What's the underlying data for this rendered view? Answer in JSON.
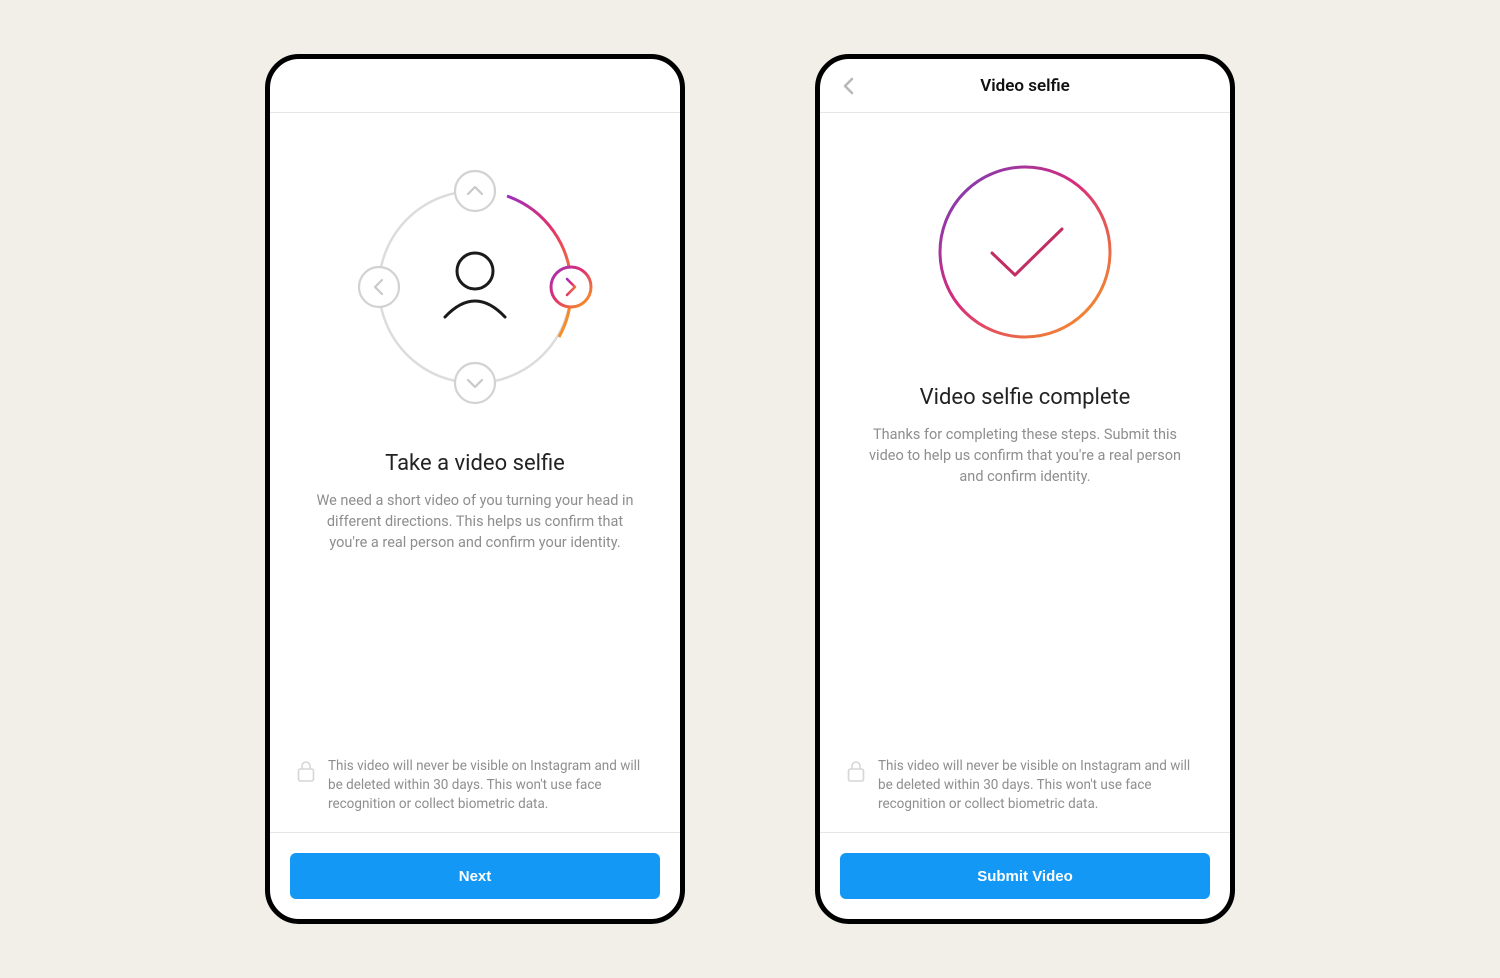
{
  "screens": {
    "left": {
      "header_title": "",
      "title": "Take a video selfie",
      "description": "We need a short video of you turning your head in different directions. This helps us confirm that you're a real person and confirm your identity.",
      "privacy_note": "This video will never be visible on Instagram and will be deleted within 30 days. This won't use face recognition or collect biometric data.",
      "cta_label": "Next"
    },
    "right": {
      "header_title": "Video selfie",
      "title": "Video selfie complete",
      "description": "Thanks for completing these steps. Submit this video to help us confirm that you're a real person and confirm identity.",
      "privacy_note": "This video will never be visible on Instagram and will be deleted within 30 days. This won't use face recognition or collect biometric data.",
      "cta_label": "Submit Video"
    }
  },
  "colors": {
    "button": "#1398f6",
    "text_muted": "#8e8e8e",
    "gradient_purple": "#9b2fbf",
    "gradient_pink": "#e1306c",
    "gradient_orange": "#f9a01b"
  }
}
